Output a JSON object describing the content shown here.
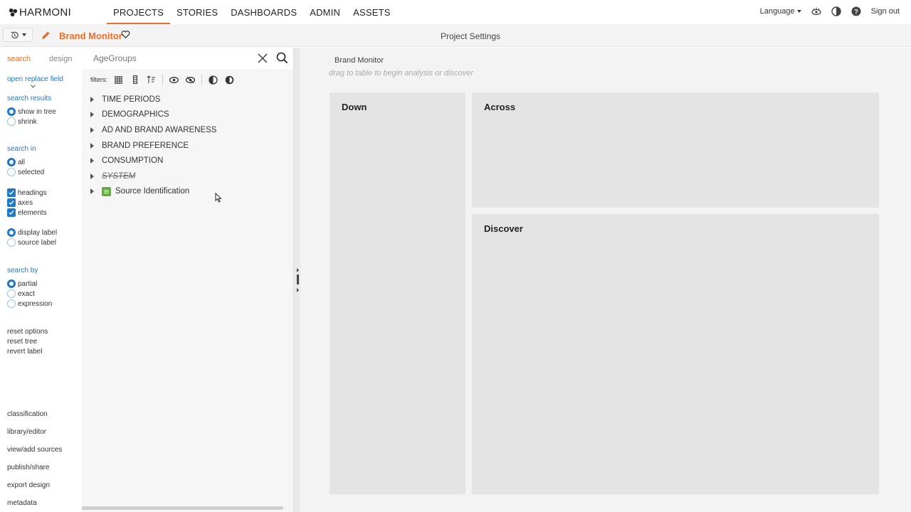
{
  "brand": {
    "name": "HARMONI",
    "logo_icon": "harmoni-logo-icon"
  },
  "nav": {
    "items": [
      {
        "label": "PROJECTS",
        "active": true
      },
      {
        "label": "STORIES",
        "active": false
      },
      {
        "label": "DASHBOARDS",
        "active": false
      },
      {
        "label": "ADMIN",
        "active": false
      },
      {
        "label": "ASSETS",
        "active": false
      }
    ],
    "accent_color": "#e8702a"
  },
  "topright": {
    "language_label": "Language",
    "sign_out_label": "Sign out",
    "icons": [
      "view-icon",
      "contrast-icon",
      "help-icon"
    ]
  },
  "subbar": {
    "project_name": "Brand Monitor",
    "title": "Project Settings",
    "icons": [
      "history-icon",
      "edit-icon",
      "heart-icon"
    ]
  },
  "left_panel": {
    "tabs": [
      {
        "label": "search",
        "active": true
      },
      {
        "label": "design",
        "active": false
      }
    ],
    "open_replace": "open replace field",
    "search_results": {
      "heading": "search results",
      "options": [
        {
          "label": "show in tree",
          "selected": true
        },
        {
          "label": "shrink",
          "selected": false
        }
      ]
    },
    "search_in": {
      "heading": "search in",
      "scope": [
        {
          "label": "all",
          "selected": true
        },
        {
          "label": "selected",
          "selected": false
        }
      ],
      "types": [
        {
          "label": "headings",
          "checked": true
        },
        {
          "label": "axes",
          "checked": true
        },
        {
          "label": "elements",
          "checked": true
        }
      ],
      "label_mode": [
        {
          "label": "display label",
          "selected": true
        },
        {
          "label": "source label",
          "selected": false
        }
      ]
    },
    "search_by": {
      "heading": "search by",
      "options": [
        {
          "label": "partial",
          "selected": true
        },
        {
          "label": "exact",
          "selected": false
        },
        {
          "label": "expression",
          "selected": false
        }
      ]
    },
    "resets": [
      "reset options",
      "reset tree",
      "revert label"
    ],
    "bottom_links": [
      "classification",
      "library/editor",
      "view/add sources",
      "publish/share",
      "export design",
      "metadata"
    ],
    "link_color": "#1e78c8"
  },
  "tree_panel": {
    "search_value": "AgeGroups",
    "filters_label": "filters:",
    "items": [
      {
        "label": "TIME PERIODS",
        "style": "normal"
      },
      {
        "label": "DEMOGRAPHICS",
        "style": "normal"
      },
      {
        "label": "AD AND BRAND AWARENESS",
        "style": "normal"
      },
      {
        "label": "BRAND PREFERENCE",
        "style": "normal"
      },
      {
        "label": "CONSUMPTION",
        "style": "normal"
      },
      {
        "label": "SYSTEM",
        "style": "struck-italic"
      },
      {
        "label": "Source Identification",
        "style": "source"
      }
    ]
  },
  "workspace": {
    "title": "Brand Monitor",
    "hint": "drag to table to begin analysis or discover",
    "zones": {
      "down": "Down",
      "across": "Across",
      "discover": "Discover"
    }
  }
}
